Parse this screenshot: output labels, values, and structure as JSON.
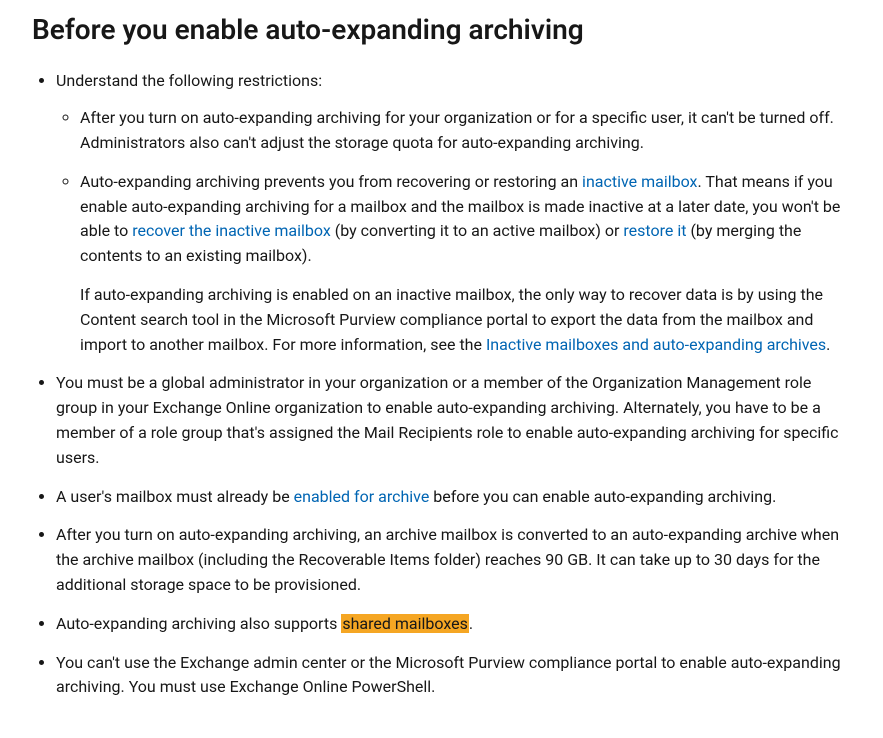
{
  "heading": "Before you enable auto-expanding archiving",
  "b1_intro": "Understand the following restrictions:",
  "b1a": "After you turn on auto-expanding archiving for your organization or for a specific user, it can't be turned off. Administrators also can't adjust the storage quota for auto-expanding archiving.",
  "b1b_pre": "Auto-expanding archiving prevents you from recovering or restoring an ",
  "b1b_link1": "inactive mailbox",
  "b1b_mid1": ". That means if you enable auto-expanding archiving for a mailbox and the mailbox is made inactive at a later date, you won't be able to ",
  "b1b_link2": "recover the inactive mailbox",
  "b1b_mid2": " (by converting it to an active mailbox) or ",
  "b1b_link3": "restore it",
  "b1b_end": " (by merging the contents to an existing mailbox).",
  "b1b_para2_pre": "If auto-expanding archiving is enabled on an inactive mailbox, the only way to recover data is by using the Content search tool in the Microsoft Purview compliance portal to export the data from the mailbox and import to another mailbox. For more information, see the ",
  "b1b_para2_link": "Inactive mailboxes and auto-expanding archives",
  "b1b_para2_end": ".",
  "b2": "You must be a global administrator in your organization or a member of the Organization Management role group in your Exchange Online organization to enable auto-expanding archiving. Alternately, you have to be a member of a role group that's assigned the Mail Recipients role to enable auto-expanding archiving for specific users.",
  "b3_pre": "A user's mailbox must already be ",
  "b3_link": "enabled for archive",
  "b3_end": " before you can enable auto-expanding archiving.",
  "b4": "After you turn on auto-expanding archiving, an archive mailbox is converted to an auto-expanding archive when the archive mailbox (including the Recoverable Items folder) reaches 90 GB. It can take up to 30 days for the additional storage space to be provisioned.",
  "b5_pre": "Auto-expanding archiving also supports ",
  "b5_hl": "shared mailboxes",
  "b5_end": ".",
  "b6": "You can't use the Exchange admin center or the Microsoft Purview compliance portal to enable auto-expanding archiving. You must use Exchange Online PowerShell."
}
